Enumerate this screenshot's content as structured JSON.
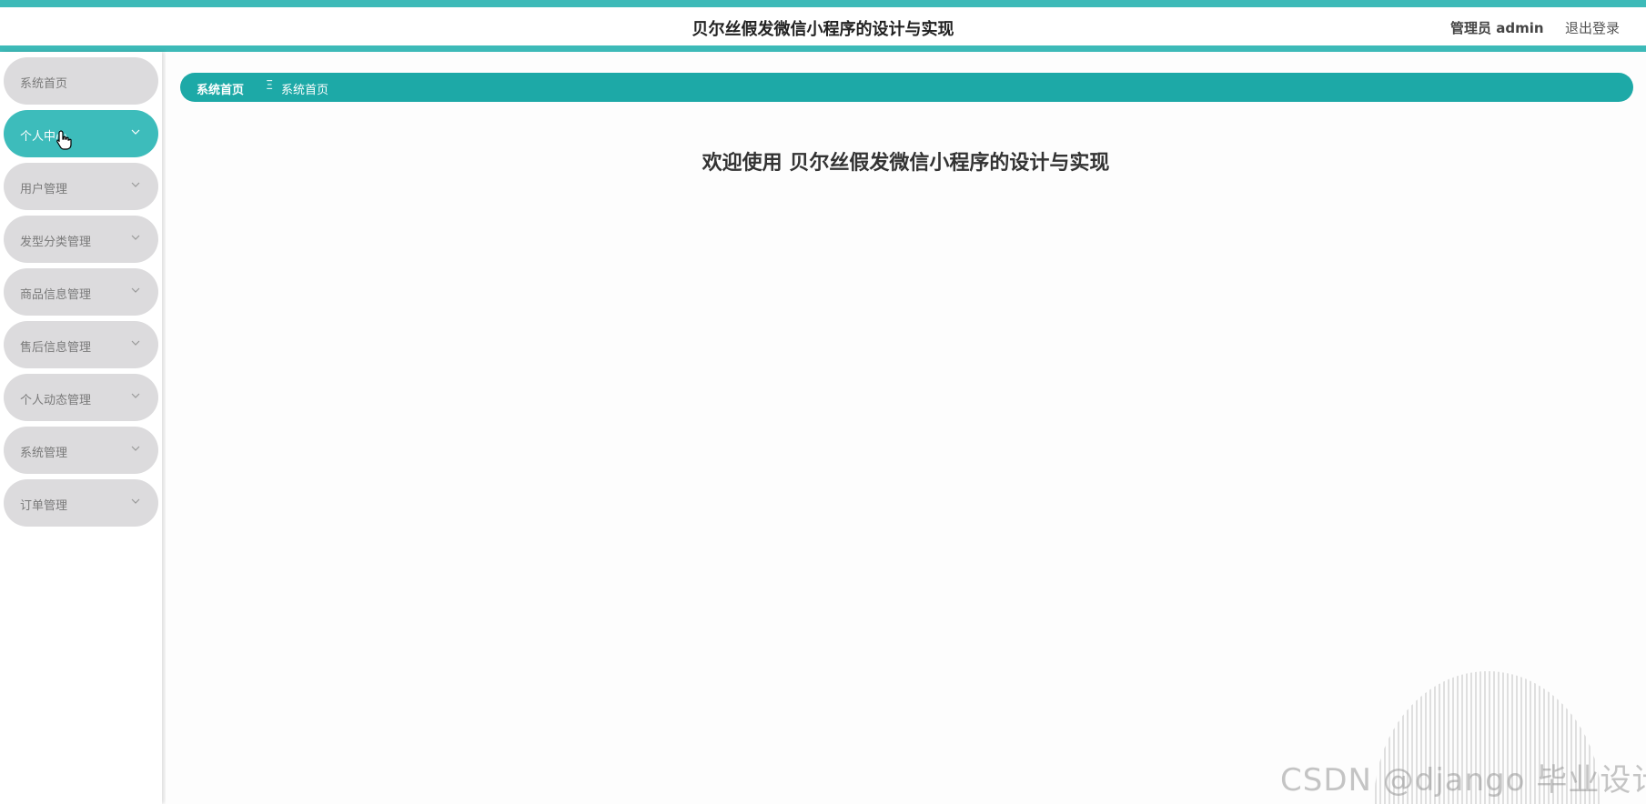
{
  "header": {
    "title": "贝尔丝假发微信小程序的设计与实现",
    "admin_label": "管理员 admin",
    "logout_label": "退出登录"
  },
  "sidebar": {
    "items": [
      {
        "label": "系统首页",
        "has_chevron": false,
        "active": false
      },
      {
        "label": "个人中心",
        "has_chevron": true,
        "active": true
      },
      {
        "label": "用户管理",
        "has_chevron": true,
        "active": false
      },
      {
        "label": "发型分类管理",
        "has_chevron": true,
        "active": false
      },
      {
        "label": "商品信息管理",
        "has_chevron": true,
        "active": false
      },
      {
        "label": "售后信息管理",
        "has_chevron": true,
        "active": false
      },
      {
        "label": "个人动态管理",
        "has_chevron": true,
        "active": false
      },
      {
        "label": "系统管理",
        "has_chevron": true,
        "active": false
      },
      {
        "label": "订单管理",
        "has_chevron": true,
        "active": false
      }
    ]
  },
  "breadcrumb": {
    "home": "系统首页",
    "separator": "Ξ",
    "current": "系统首页"
  },
  "main": {
    "welcome": "欢迎使用 贝尔丝假发微信小程序的设计与实现"
  },
  "watermark": "CSDN @django 毕业设计",
  "colors": {
    "accent": "#3dbab8",
    "breadcrumb": "#1da9a7",
    "menu_bg": "#dcdbdd",
    "menu_active": "#3dbcbb"
  }
}
